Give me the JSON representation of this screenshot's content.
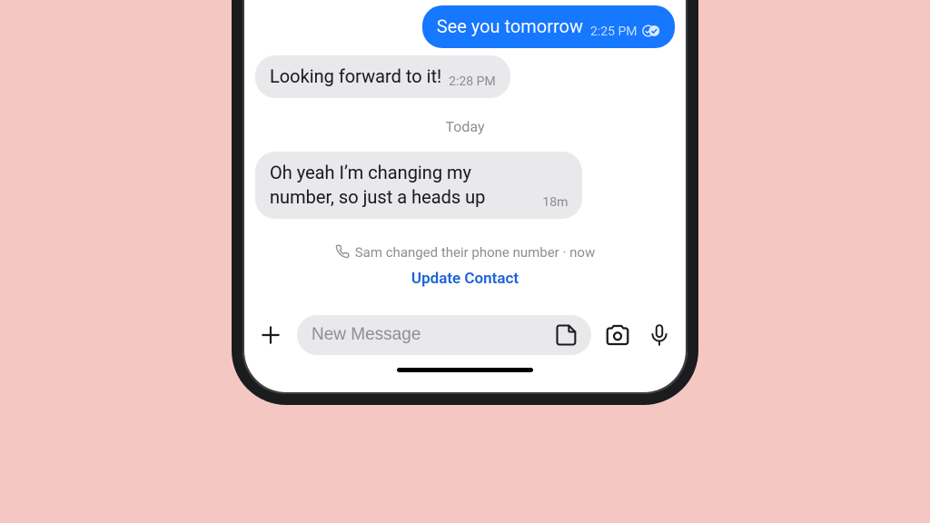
{
  "messages": [
    {
      "direction": "out",
      "text": "See you tomorrow",
      "time": "2:25 PM",
      "read": true
    },
    {
      "direction": "in",
      "text": "Looking forward to it!",
      "time": "2:28 PM"
    }
  ],
  "date_separator": "Today",
  "messages2": [
    {
      "direction": "in",
      "text": "Oh yeah I’m changing my number, so just a heads up",
      "time": "18m"
    }
  ],
  "system_event": {
    "text": "Sam changed their phone number · now",
    "action": "Update Contact"
  },
  "composer": {
    "placeholder": "New Message"
  }
}
